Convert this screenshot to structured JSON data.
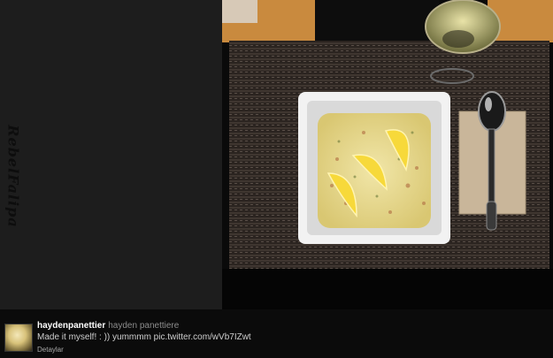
{
  "watermark": {
    "text": "RebelFalipa"
  },
  "tweet": {
    "username": "haydenpanettier",
    "fullname": "hayden panettiere",
    "text": "Made it myself! : )) yummmm pic.twitter.com/wVb7IZwt",
    "details_label": "Detaylar"
  },
  "photo": {
    "icons": {
      "avatar": "avatar-photo"
    },
    "colors": {
      "placemat": "#2b2420",
      "bowl": "#f2f2f2",
      "soup": "#e7d98a",
      "lemon": "#f7d93a",
      "table": "#c98a3e"
    }
  }
}
